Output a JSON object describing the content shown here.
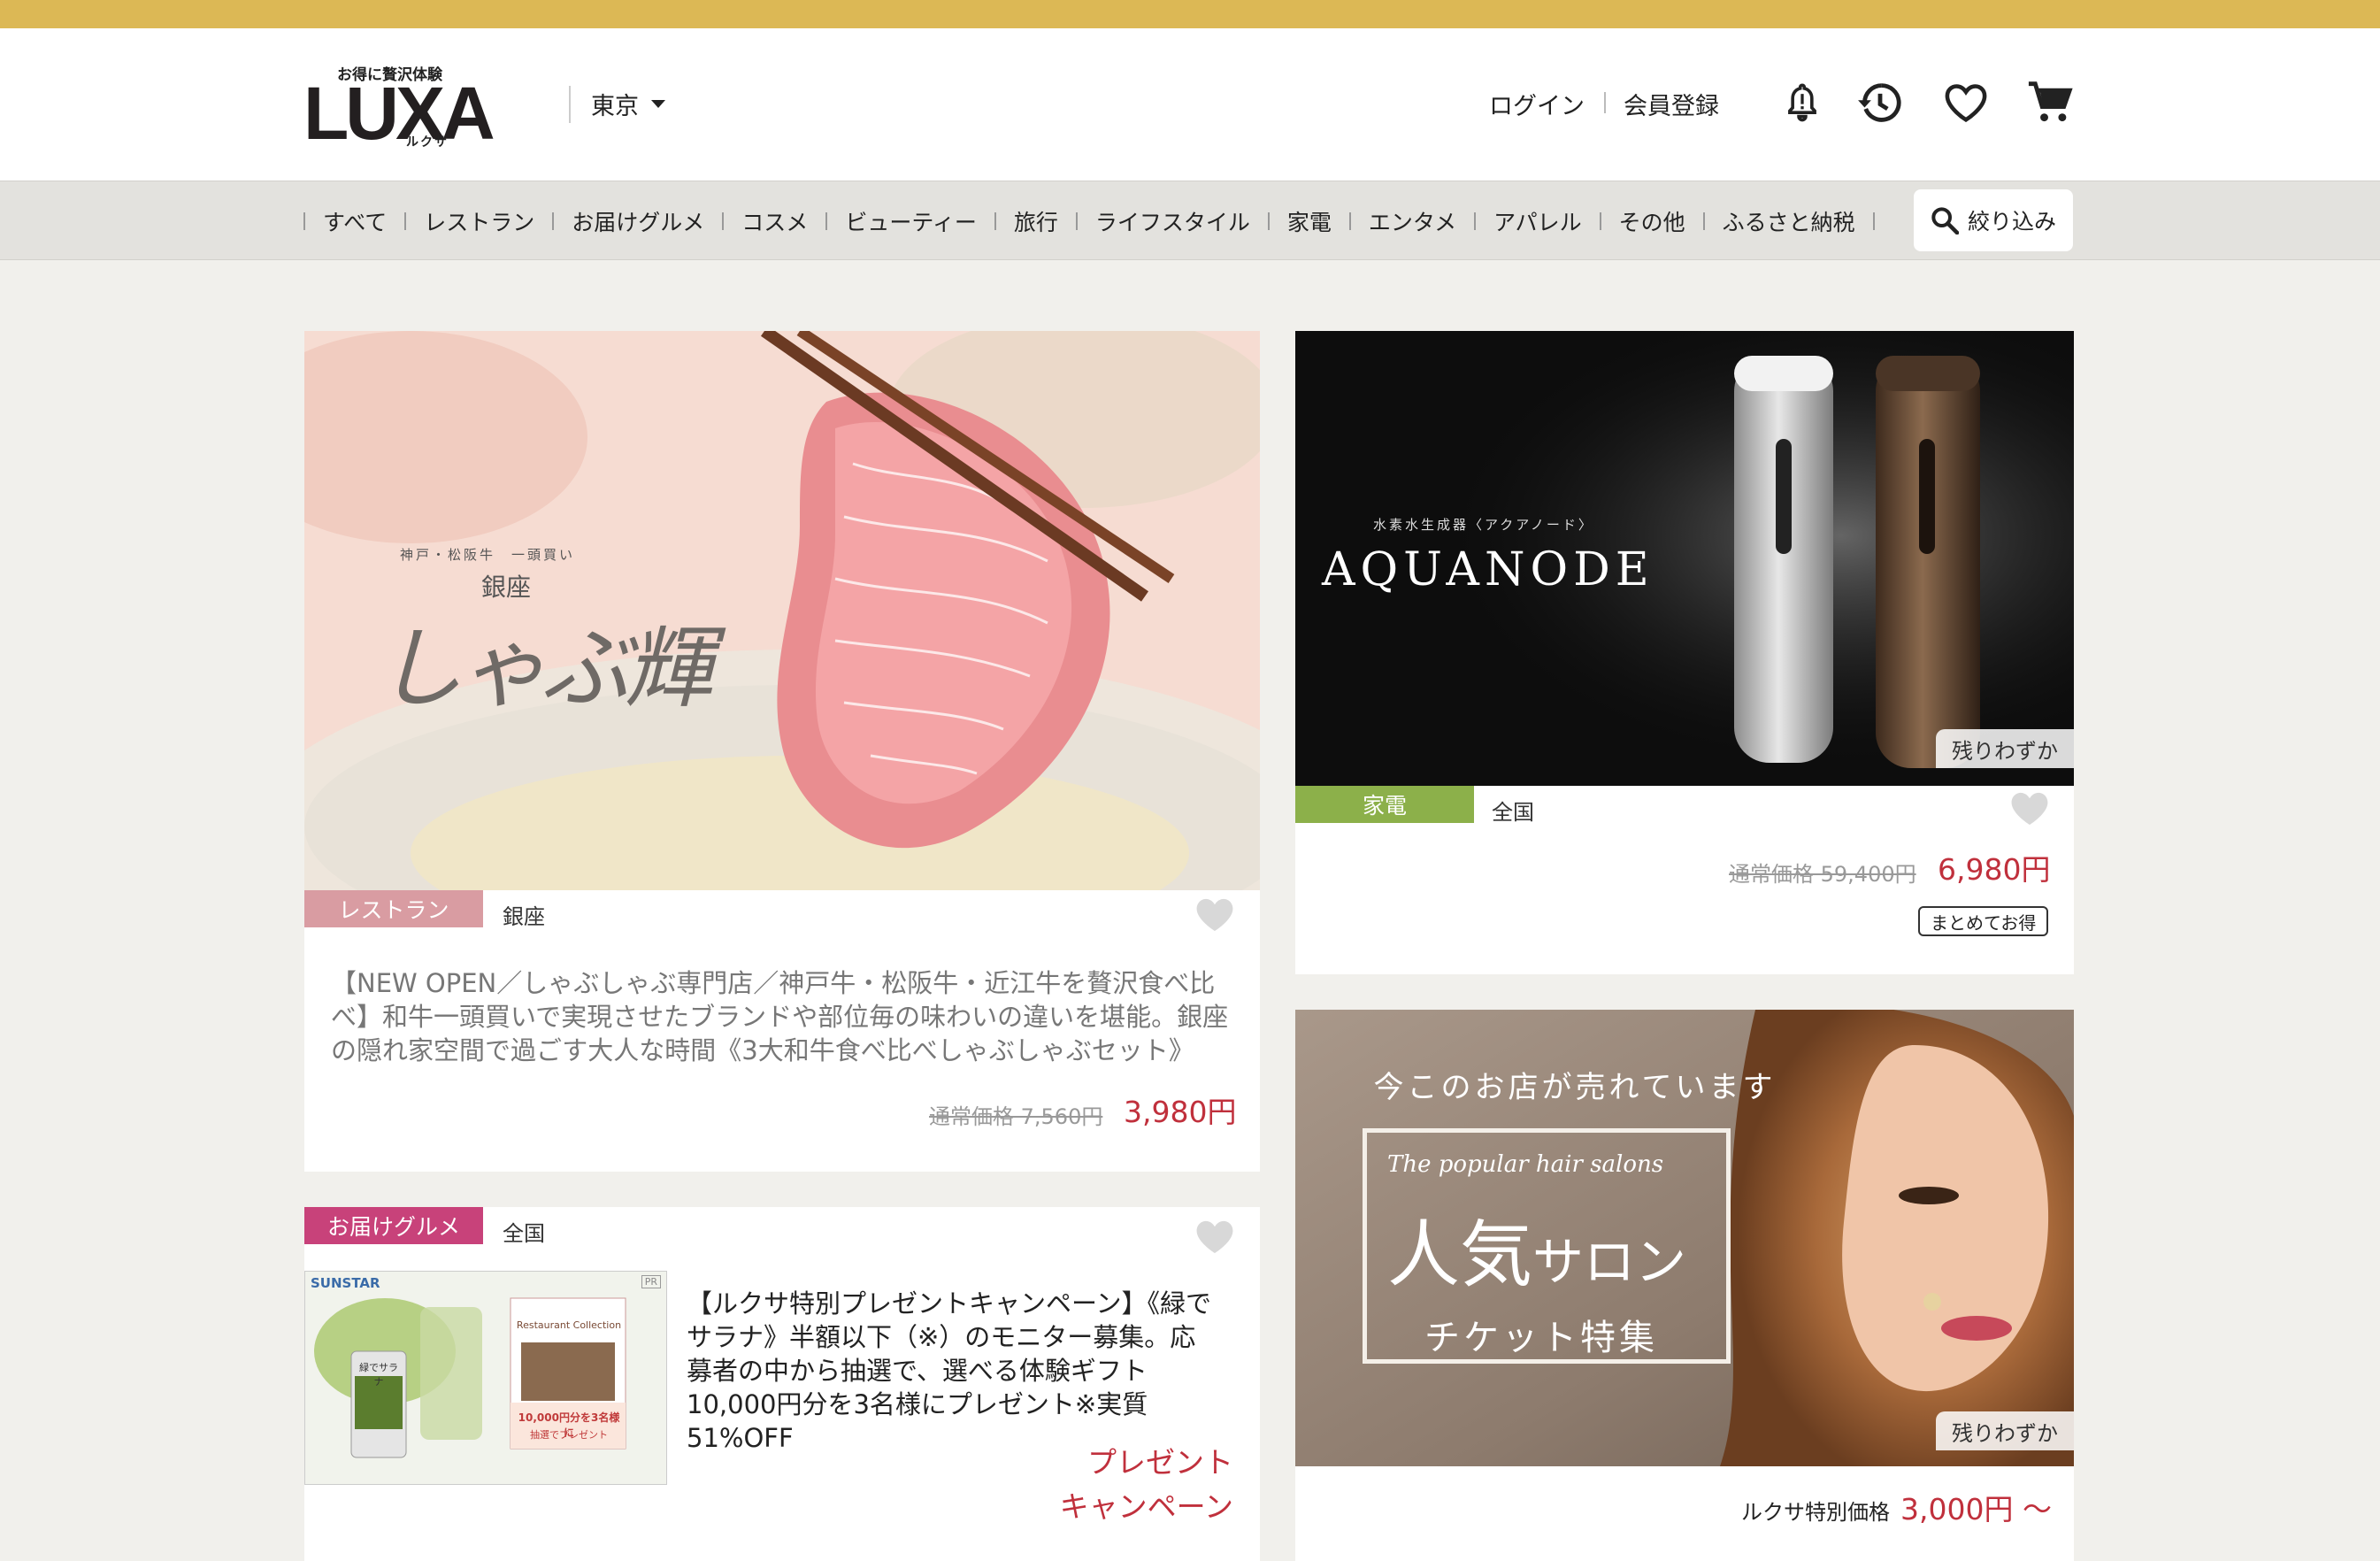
{
  "header": {
    "logo_tagline": "お得に贅沢体験",
    "logo_text": "LUXA",
    "logo_kana": "ルクサ",
    "location": "東京",
    "login": "ログイン",
    "register": "会員登録",
    "icons": [
      "bell-icon",
      "history-icon",
      "heart-icon",
      "cart-icon"
    ]
  },
  "nav": {
    "items": [
      "すべて",
      "レストラン",
      "お届けグルメ",
      "コスメ",
      "ビューティー",
      "旅行",
      "ライフスタイル",
      "家電",
      "エンタメ",
      "アパレル",
      "その他",
      "ふるさと納税"
    ],
    "filter_label": "絞り込み"
  },
  "cards": {
    "restaurant": {
      "image_title": "しゃぶ輝",
      "image_subtitle": "神戸・松阪牛　一頭買い",
      "image_small": "銀座",
      "category": "レストラン",
      "category_color": "#d99ca2",
      "area": "銀座",
      "description": "【NEW OPEN／しゃぶしゃぶ専門店／神戸牛・松阪牛・近江牛を贅沢食べ比べ】和牛一頭買いで実現させたブランドや部位毎の味わいの違いを堪能。銀座の隠れ家空間で過ごす大人な時間《3大和牛食べ比べしゃぶしゃぶセット》",
      "old_price": "通常価格  7,560円",
      "price": "3,980円"
    },
    "aquanode": {
      "image_subtitle": "水素水生成器〈アクアノード〉",
      "image_title": "AQUANODE",
      "badge": "残りわずか",
      "category": "家電",
      "category_color": "#8cb04a",
      "area": "全国",
      "old_price": "通常価格  59,400円",
      "price": "6,980円",
      "bundle_label": "まとめてお得"
    },
    "gourmet": {
      "category": "お届けグルメ",
      "category_color": "#c8427a",
      "area": "全国",
      "ad_brand": "SUNSTAR",
      "ad_pr": "PR",
      "ad_can_label": "緑でサラナ",
      "ad_box_title": "Restaurant Collection",
      "ad_box_line1": "10,000円分を3名様に",
      "ad_box_line2": "抽選でプレゼント",
      "description": "【ルクサ特別プレゼントキャンペーン】《緑でサラナ》半額以下（※）のモニター募集。応募者の中から抽選で、選べる体験ギフト10,000円分を3名様にプレゼント※実質51%OFF",
      "campaign_line1": "プレゼント",
      "campaign_line2": "キャンペーン"
    },
    "salon": {
      "image_heading": "今このお店が売れています",
      "image_script": "The popular hair salons",
      "image_title_a": "人気",
      "image_title_b": "サロン",
      "image_sub": "チケット特集",
      "badge": "残りわずか",
      "price_label": "ルクサ特別価格",
      "price": "3,000円 〜"
    }
  }
}
